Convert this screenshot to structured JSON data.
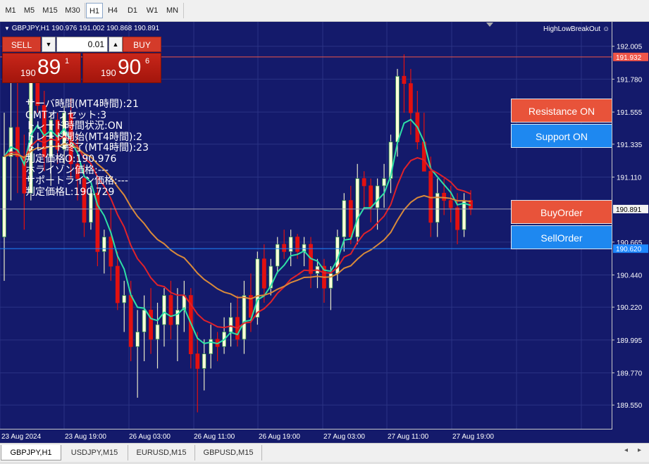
{
  "timeframes": [
    {
      "label": "M1",
      "active": false
    },
    {
      "label": "M5",
      "active": false
    },
    {
      "label": "M15",
      "active": false
    },
    {
      "label": "M30",
      "active": false
    },
    {
      "label": "H1",
      "active": true
    },
    {
      "label": "H4",
      "active": false
    },
    {
      "label": "D1",
      "active": false
    },
    {
      "label": "W1",
      "active": false
    },
    {
      "label": "MN",
      "active": false
    }
  ],
  "chart": {
    "header": "GBPJPY,H1  190.976 191.002 190.868 190.891",
    "indicator_name": "HighLowBreakOut",
    "price_labels": [
      "192.005",
      "191.780",
      "191.555",
      "191.335",
      "191.110",
      "190.665",
      "190.440",
      "190.220",
      "189.995",
      "189.770",
      "189.550"
    ],
    "resistance_label": "191.932",
    "current_label": "190.891",
    "support_label": "190.620",
    "time_labels": [
      "23 Aug 2024",
      "23 Aug 19:00",
      "26 Aug 03:00",
      "26 Aug 11:00",
      "26 Aug 19:00",
      "27 Aug 03:00",
      "27 Aug 11:00",
      "27 Aug 19:00"
    ],
    "colors": {
      "background": "#141a6b",
      "bull_fill": "#ffffd8",
      "bear": "#e21010",
      "ma_fast": "#2ee0a6",
      "ma_mid": "#e0222a",
      "ma_slow": "#d98a3a",
      "resistance": "#ef5548",
      "support": "#1e88ff",
      "current": "#a0a0b8"
    }
  },
  "trade": {
    "sell_label": "SELL",
    "buy_label": "BUY",
    "lot": "0.01",
    "sell_small": "190",
    "sell_big": "89",
    "sell_sup": "1",
    "buy_small": "190",
    "buy_big": "90",
    "buy_sup": "6"
  },
  "info_lines": [
    "サーバ時間(MT4時間):21",
    "GMTオフセット:3",
    "トレード時間状況:ON",
    "トレード開始(MT4時間):2",
    "トレード終了(MT4時間):23",
    "判定価格O:190.976",
    "ホライゾン価格:---",
    "サポートライン価格:---",
    "判定価格L:190.729"
  ],
  "buttons": {
    "resistance": {
      "label": "Resistance ON",
      "color": "#e8533a"
    },
    "support": {
      "label": "Support ON",
      "color": "#1e88f0"
    },
    "buy": {
      "label": "BuyOrder",
      "color": "#e8533a"
    },
    "sell": {
      "label": "SellOrder",
      "color": "#1e88f0"
    }
  },
  "tabs": [
    {
      "label": "GBPJPY,H1",
      "active": true
    },
    {
      "label": "USDJPY,M15",
      "active": false
    },
    {
      "label": "EURUSD,M15",
      "active": false
    },
    {
      "label": "GBPUSD,M15",
      "active": false
    }
  ],
  "chart_data": {
    "type": "candlestick",
    "symbol": "GBPJPY",
    "timeframe": "H1",
    "ylim": [
      189.45,
      192.1
    ],
    "candles": [
      [
        190.7,
        191.55,
        190.4,
        191.25
      ],
      [
        191.25,
        191.95,
        190.95,
        191.45
      ],
      [
        191.45,
        191.8,
        191.0,
        191.25
      ],
      [
        191.25,
        191.4,
        190.75,
        191.0
      ],
      [
        191.0,
        191.85,
        190.95,
        191.8
      ],
      [
        191.8,
        191.95,
        191.55,
        191.6
      ],
      [
        191.6,
        191.7,
        191.15,
        191.25
      ],
      [
        191.25,
        191.55,
        191.05,
        191.5
      ],
      [
        191.5,
        191.55,
        191.2,
        191.3
      ],
      [
        191.3,
        191.6,
        191.2,
        191.55
      ],
      [
        191.55,
        191.65,
        191.1,
        191.2
      ],
      [
        191.2,
        191.4,
        190.95,
        191.1
      ],
      [
        191.1,
        191.2,
        190.7,
        190.8
      ],
      [
        190.8,
        191.05,
        190.75,
        191.0
      ],
      [
        191.0,
        191.1,
        190.5,
        190.6
      ],
      [
        190.6,
        190.75,
        190.45,
        190.7
      ],
      [
        190.7,
        190.9,
        190.4,
        190.5
      ],
      [
        190.5,
        190.6,
        190.2,
        190.25
      ],
      [
        190.25,
        190.4,
        190.05,
        190.3
      ],
      [
        190.3,
        190.4,
        189.85,
        189.95
      ],
      [
        189.95,
        190.2,
        189.6,
        190.05
      ],
      [
        190.05,
        190.3,
        189.85,
        190.2
      ],
      [
        190.2,
        190.35,
        189.9,
        190.0
      ],
      [
        190.0,
        190.25,
        189.8,
        190.1
      ],
      [
        190.1,
        190.35,
        189.95,
        190.3
      ],
      [
        190.3,
        190.4,
        190.0,
        190.1
      ],
      [
        190.1,
        190.35,
        189.85,
        190.2
      ],
      [
        190.2,
        190.4,
        190.05,
        190.3
      ],
      [
        190.3,
        190.35,
        189.8,
        189.9
      ],
      [
        189.9,
        190.05,
        189.5,
        189.8
      ],
      [
        189.8,
        190.0,
        189.65,
        189.9
      ],
      [
        189.9,
        190.1,
        189.8,
        190.0
      ],
      [
        190.0,
        190.05,
        189.85,
        189.95
      ],
      [
        189.95,
        190.15,
        189.9,
        190.05
      ],
      [
        190.05,
        190.25,
        189.95,
        190.15
      ],
      [
        190.15,
        190.3,
        189.95,
        190.0
      ],
      [
        190.0,
        190.4,
        189.9,
        190.3
      ],
      [
        190.3,
        190.45,
        190.05,
        190.15
      ],
      [
        190.15,
        190.6,
        190.1,
        190.55
      ],
      [
        190.55,
        190.65,
        190.25,
        190.35
      ],
      [
        190.35,
        190.55,
        190.3,
        190.5
      ],
      [
        190.5,
        190.7,
        190.45,
        190.65
      ],
      [
        190.65,
        190.75,
        190.55,
        190.6
      ],
      [
        190.6,
        190.75,
        190.5,
        190.7
      ],
      [
        190.7,
        190.72,
        190.55,
        190.6
      ],
      [
        190.6,
        190.7,
        190.5,
        190.65
      ],
      [
        190.65,
        190.7,
        190.35,
        190.45
      ],
      [
        190.45,
        190.55,
        190.35,
        190.5
      ],
      [
        190.5,
        190.55,
        190.25,
        190.35
      ],
      [
        190.35,
        190.5,
        190.2,
        190.45
      ],
      [
        190.45,
        190.75,
        190.4,
        190.7
      ],
      [
        190.7,
        191.0,
        190.6,
        190.95
      ],
      [
        190.95,
        191.05,
        190.65,
        190.7
      ],
      [
        190.7,
        191.2,
        190.65,
        191.1
      ],
      [
        191.1,
        191.15,
        190.9,
        191.05
      ],
      [
        191.05,
        191.1,
        190.8,
        190.9
      ],
      [
        190.9,
        191.1,
        190.75,
        191.05
      ],
      [
        191.05,
        191.2,
        190.9,
        191.1
      ],
      [
        191.1,
        191.4,
        191.0,
        191.35
      ],
      [
        191.35,
        191.85,
        191.25,
        191.8
      ],
      [
        191.8,
        191.95,
        191.55,
        191.75
      ],
      [
        191.75,
        191.85,
        191.4,
        191.55
      ],
      [
        191.55,
        191.7,
        191.3,
        191.35
      ],
      [
        191.35,
        191.55,
        191.2,
        191.15
      ],
      [
        191.15,
        191.25,
        190.7,
        190.8
      ],
      [
        190.8,
        191.1,
        190.7,
        191.0
      ],
      [
        191.0,
        191.1,
        190.85,
        190.95
      ],
      [
        190.95,
        191.05,
        190.8,
        190.9
      ],
      [
        190.9,
        191.0,
        190.65,
        190.75
      ],
      [
        190.75,
        191.0,
        190.7,
        190.95
      ],
      [
        190.95,
        191.02,
        190.85,
        190.89
      ]
    ]
  }
}
